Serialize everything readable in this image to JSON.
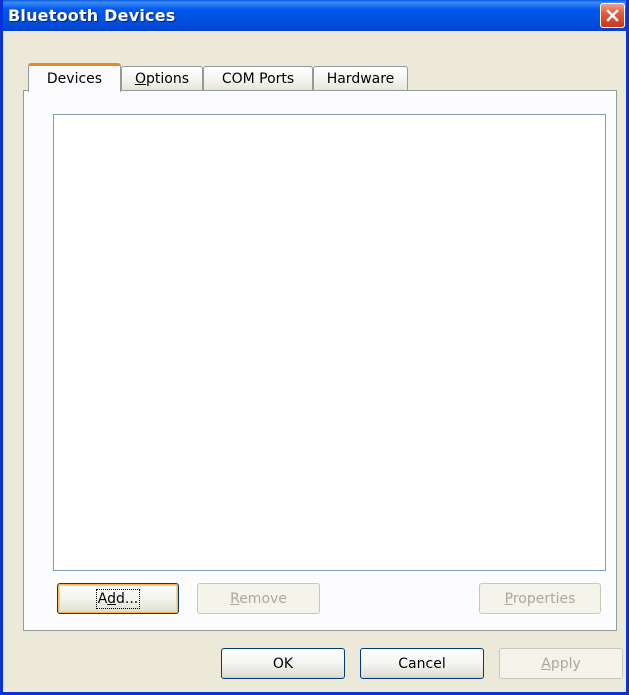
{
  "window": {
    "title": "Bluetooth Devices",
    "colors": {
      "titlebar": "#0058ee",
      "face": "#ece9d8",
      "active_tab_accent": "#e68b2c",
      "close": "#e45a3a"
    }
  },
  "tabs": [
    {
      "label": "Devices",
      "accel": "",
      "rest": "Devices",
      "active": true
    },
    {
      "label": "Options",
      "accel": "O",
      "rest": "ptions",
      "active": false
    },
    {
      "label": "COM Ports",
      "accel": "",
      "rest": "COM Ports",
      "active": false
    },
    {
      "label": "Hardware",
      "accel": "",
      "rest": "Hardware",
      "active": false
    }
  ],
  "device_list": {
    "items": []
  },
  "panel_buttons": {
    "add": {
      "label": "Add...",
      "pre": "A",
      "accel": "d",
      "post": "d...",
      "enabled": true
    },
    "remove": {
      "label": "Remove",
      "accel": "R",
      "rest": "emove",
      "enabled": false
    },
    "properties": {
      "label": "Properties",
      "accel": "P",
      "rest": "roperties",
      "enabled": false
    }
  },
  "dialog_buttons": {
    "ok": {
      "label": "OK",
      "enabled": true
    },
    "cancel": {
      "label": "Cancel",
      "enabled": true
    },
    "apply": {
      "label": "Apply",
      "accel": "A",
      "rest": "pply",
      "enabled": false
    }
  },
  "icons": {
    "close": "close-icon"
  }
}
